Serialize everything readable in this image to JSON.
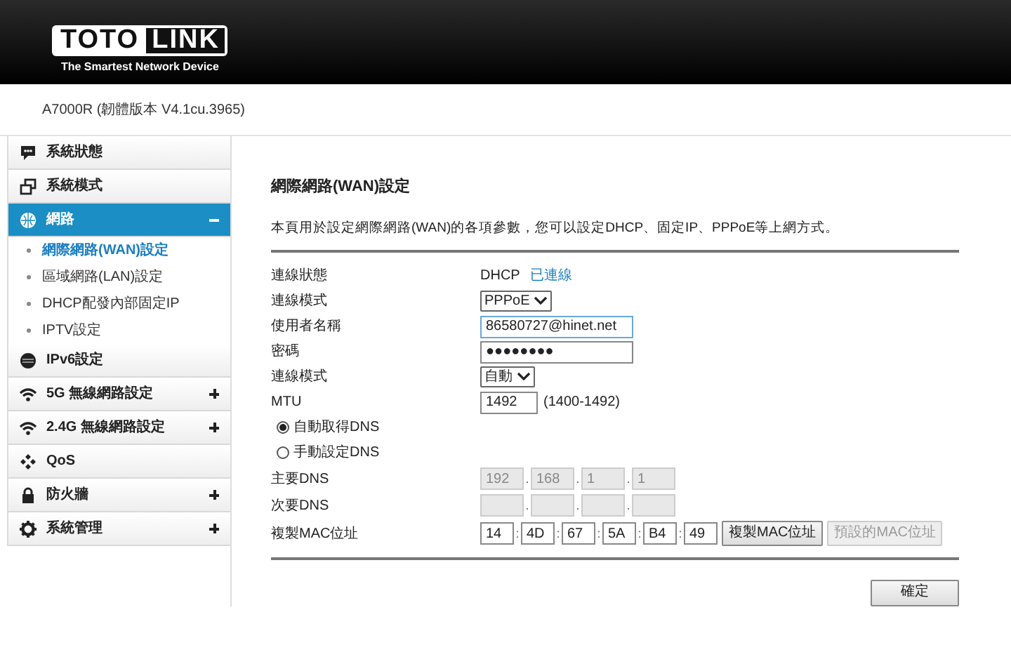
{
  "header": {
    "logo_left": "TOTO",
    "logo_right": "LINK",
    "tagline": "The Smartest Network Device"
  },
  "model": "A7000R (韌體版本 V4.1cu.3965)",
  "sidebar": {
    "items": [
      {
        "label": "系統狀態",
        "selected": false
      },
      {
        "label": "系統模式",
        "selected": false
      },
      {
        "label": "網路",
        "selected": true,
        "expanded": true,
        "children": [
          {
            "label": "網際網路(WAN)設定",
            "selected": true
          },
          {
            "label": "區域網路(LAN)設定",
            "selected": false
          },
          {
            "label": "DHCP配發內部固定IP",
            "selected": false
          },
          {
            "label": "IPTV設定",
            "selected": false
          }
        ]
      },
      {
        "label": "IPv6設定",
        "selected": false
      },
      {
        "label": "5G 無線網路設定",
        "selected": false,
        "expanded": false
      },
      {
        "label": "2.4G 無線網路設定",
        "selected": false,
        "expanded": false
      },
      {
        "label": "QoS",
        "selected": false
      },
      {
        "label": "防火牆",
        "selected": false,
        "expanded": false
      },
      {
        "label": "系統管理",
        "selected": false,
        "expanded": false
      }
    ]
  },
  "form": {
    "title": "網際網路(WAN)設定",
    "description": "本頁用於設定網際網路(WAN)的各項參數，您可以設定DHCP、固定IP、PPPoE等上網方式。",
    "rows": [
      {
        "kind": "status",
        "label": "連線狀態",
        "value": "DHCP",
        "status": "已連線"
      },
      {
        "kind": "select",
        "label": "連線模式",
        "value": "PPPoE"
      },
      {
        "kind": "text",
        "label": "使用者名稱",
        "value": "86580727@hinet.net",
        "focused": true
      },
      {
        "kind": "text",
        "label": "密碼",
        "value": "●●●●●●●●",
        "focused": false
      },
      {
        "kind": "select",
        "label": "連線模式",
        "value": "自動"
      },
      {
        "kind": "number",
        "label": "MTU",
        "value": "1492",
        "hint": "(1400-1492)"
      },
      {
        "kind": "radio",
        "label": "自動取得DNS",
        "selected": true
      },
      {
        "kind": "radio",
        "label": "手動設定DNS",
        "selected": false
      },
      {
        "kind": "address",
        "label": "主要DNS",
        "separator": ".",
        "parts": [
          {
            "value": "192",
            "disabled": true
          },
          {
            "value": "168",
            "disabled": true
          },
          {
            "value": "1",
            "disabled": true
          },
          {
            "value": "1",
            "disabled": true
          }
        ]
      },
      {
        "kind": "address",
        "label": "次要DNS",
        "separator": ".",
        "parts": [
          {
            "disabled": true
          },
          {
            "disabled": true
          },
          {
            "disabled": true
          },
          {
            "disabled": true
          }
        ]
      },
      {
        "kind": "address",
        "label": "複製MAC位址",
        "separator": ":",
        "parts": [
          {
            "value": "14",
            "disabled": false
          },
          {
            "value": "4D",
            "disabled": false
          },
          {
            "value": "67",
            "disabled": false
          },
          {
            "value": "5A",
            "disabled": false
          },
          {
            "value": "B4",
            "disabled": false
          },
          {
            "value": "49",
            "disabled": false
          }
        ],
        "buttons": [
          {
            "label": "複製MAC位址",
            "disabled": false
          },
          {
            "label": "預設的MAC位址",
            "disabled": true
          }
        ]
      }
    ],
    "submit": "確定"
  }
}
